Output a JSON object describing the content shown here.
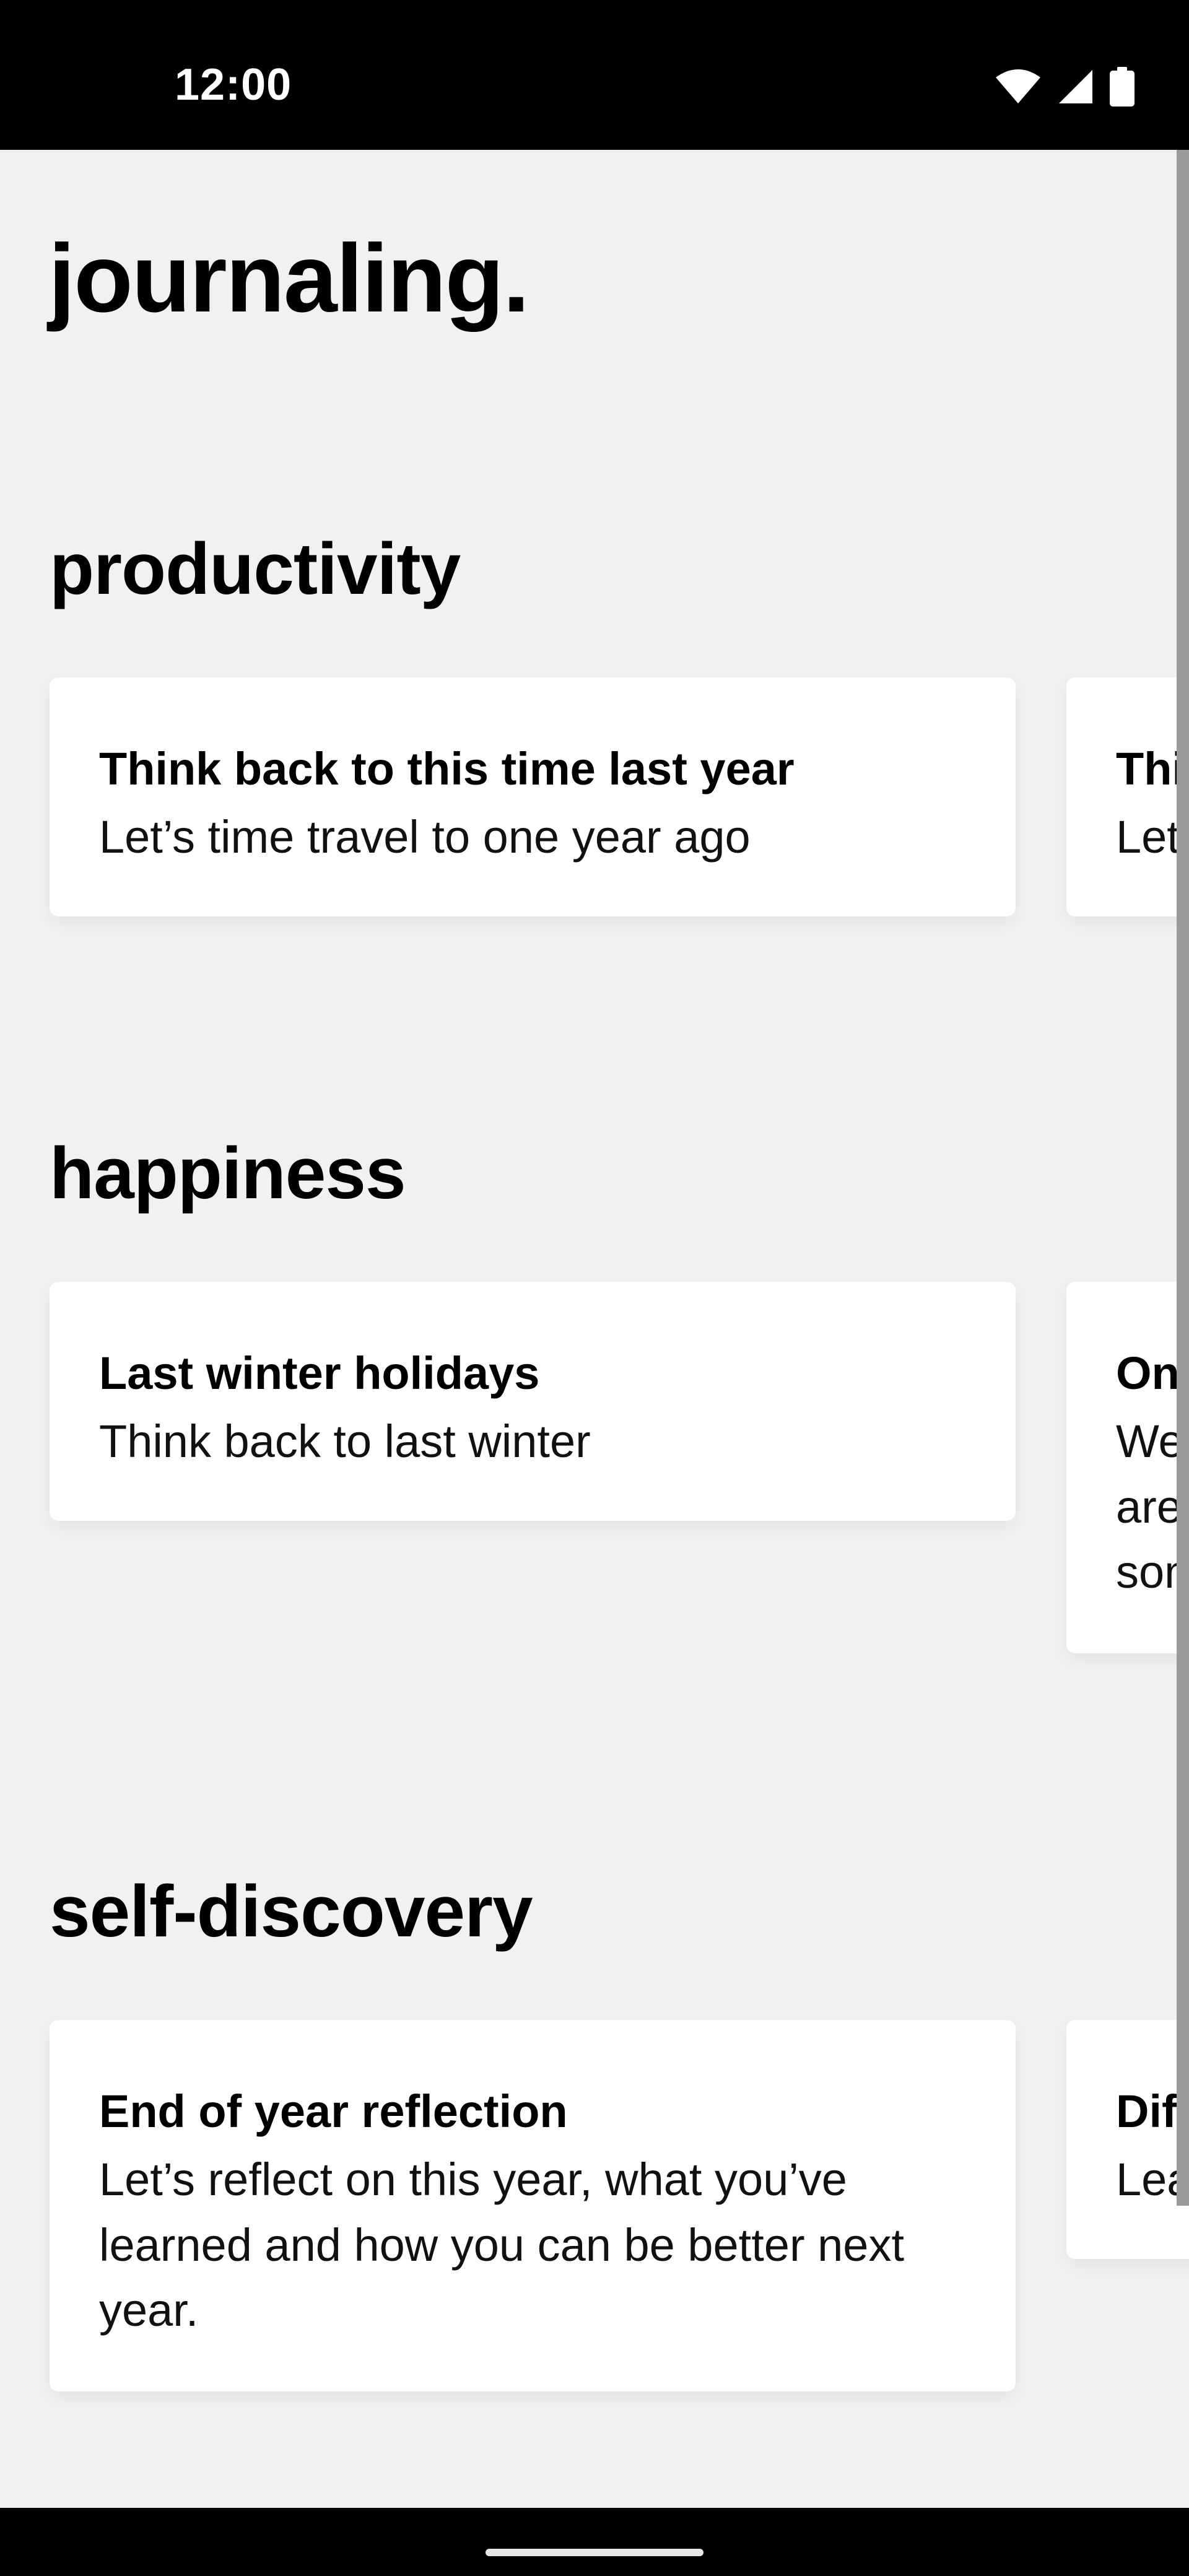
{
  "status_bar": {
    "time": "12:00"
  },
  "page": {
    "title": "journaling."
  },
  "sections": [
    {
      "title": "productivity",
      "cards": [
        {
          "title": "Think back to this time last year",
          "subtitle": "Let’s time travel to one year ago"
        },
        {
          "title": "Thi",
          "subtitle": "Let’"
        }
      ]
    },
    {
      "title": "happiness",
      "cards": [
        {
          "title": "Last winter holidays",
          "subtitle": "Think back to last winter"
        },
        {
          "title": "One",
          "subtitle": "We\nare\nsom"
        }
      ]
    },
    {
      "title": "self-discovery",
      "cards": [
        {
          "title": "End of year reflection",
          "subtitle": "Let’s reflect on this year, what you’ve learned and how you can be better next year."
        },
        {
          "title": "Diff",
          "subtitle": "Lea"
        }
      ]
    }
  ],
  "colors": {
    "background": "#f0f1f3",
    "card": "#ffffff",
    "text": "#000000",
    "status_bar": "#000000"
  },
  "icons": [
    "wifi-icon",
    "cell-signal-icon",
    "battery-icon"
  ]
}
